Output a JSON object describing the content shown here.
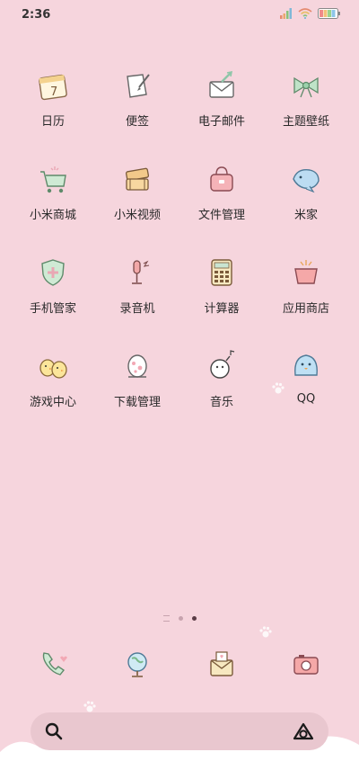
{
  "status_bar": {
    "time": "2:36"
  },
  "rows": [
    [
      {
        "label": "日历",
        "icon": "calendar-icon"
      },
      {
        "label": "便签",
        "icon": "note-icon"
      },
      {
        "label": "电子邮件",
        "icon": "email-icon"
      },
      {
        "label": "主题壁纸",
        "icon": "bow-icon"
      }
    ],
    [
      {
        "label": "小米商城",
        "icon": "cart-icon"
      },
      {
        "label": "小米视频",
        "icon": "film-icon"
      },
      {
        "label": "文件管理",
        "icon": "bag-icon"
      },
      {
        "label": "米家",
        "icon": "fish-icon"
      }
    ],
    [
      {
        "label": "手机管家",
        "icon": "shield-icon"
      },
      {
        "label": "录音机",
        "icon": "microphone-icon"
      },
      {
        "label": "计算器",
        "icon": "calculator-icon"
      },
      {
        "label": "应用商店",
        "icon": "gift-box-icon"
      }
    ],
    [
      {
        "label": "游戏中心",
        "icon": "chicks-icon"
      },
      {
        "label": "下载管理",
        "icon": "egg-icon"
      },
      {
        "label": "音乐",
        "icon": "music-bomb-icon"
      },
      {
        "label": "QQ",
        "icon": "penguin-icon"
      }
    ]
  ],
  "dock": [
    "phone-icon",
    "globe-icon",
    "messages-icon",
    "camera-icon"
  ],
  "search": {
    "left_icon": "search-icon",
    "right_icon": "assistant-icon"
  },
  "colors": {
    "background": "#f6d5dd",
    "accent": "#e9c7cf"
  }
}
